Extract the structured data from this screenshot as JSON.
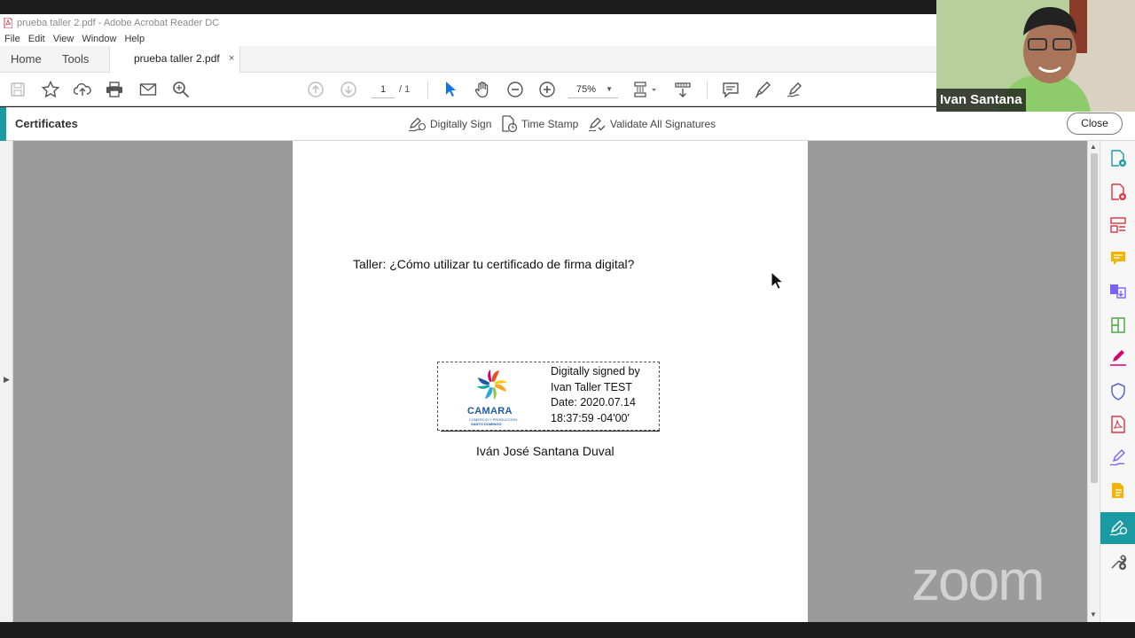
{
  "window": {
    "title": "prueba taller 2.pdf - Adobe Acrobat Reader DC"
  },
  "menu": [
    "File",
    "Edit",
    "View",
    "Window",
    "Help"
  ],
  "tabs": {
    "home": "Home",
    "tools": "Tools",
    "document": "prueba taller 2.pdf",
    "close_symbol": "×"
  },
  "toolbar": {
    "page_current": "1",
    "page_total": "/ 1",
    "zoom": "75%"
  },
  "certificates": {
    "title": "Certificates",
    "digitally_sign": "Digitally Sign",
    "time_stamp": "Time Stamp",
    "validate": "Validate All Signatures",
    "close": "Close"
  },
  "document": {
    "heading": "Taller: ¿Cómo utilizar tu certificado de firma digital?",
    "signature": {
      "line1": "Digitally signed by",
      "line2": "Ivan Taller TEST",
      "line3": "Date: 2020.07.14",
      "line4": "18:37:59 -04'00'",
      "logo_brand": "CAMARA",
      "logo_sub1": "COMERCIO Y PRODUCCION",
      "logo_sub2": "SANTO DOMINGO"
    },
    "signer_name": "Iván José Santana Duval"
  },
  "video": {
    "participant": "Ivan Santana"
  },
  "watermark": "zoom",
  "colors": {
    "accent": "#1a9ba3",
    "pdf_red": "#d7373f"
  }
}
